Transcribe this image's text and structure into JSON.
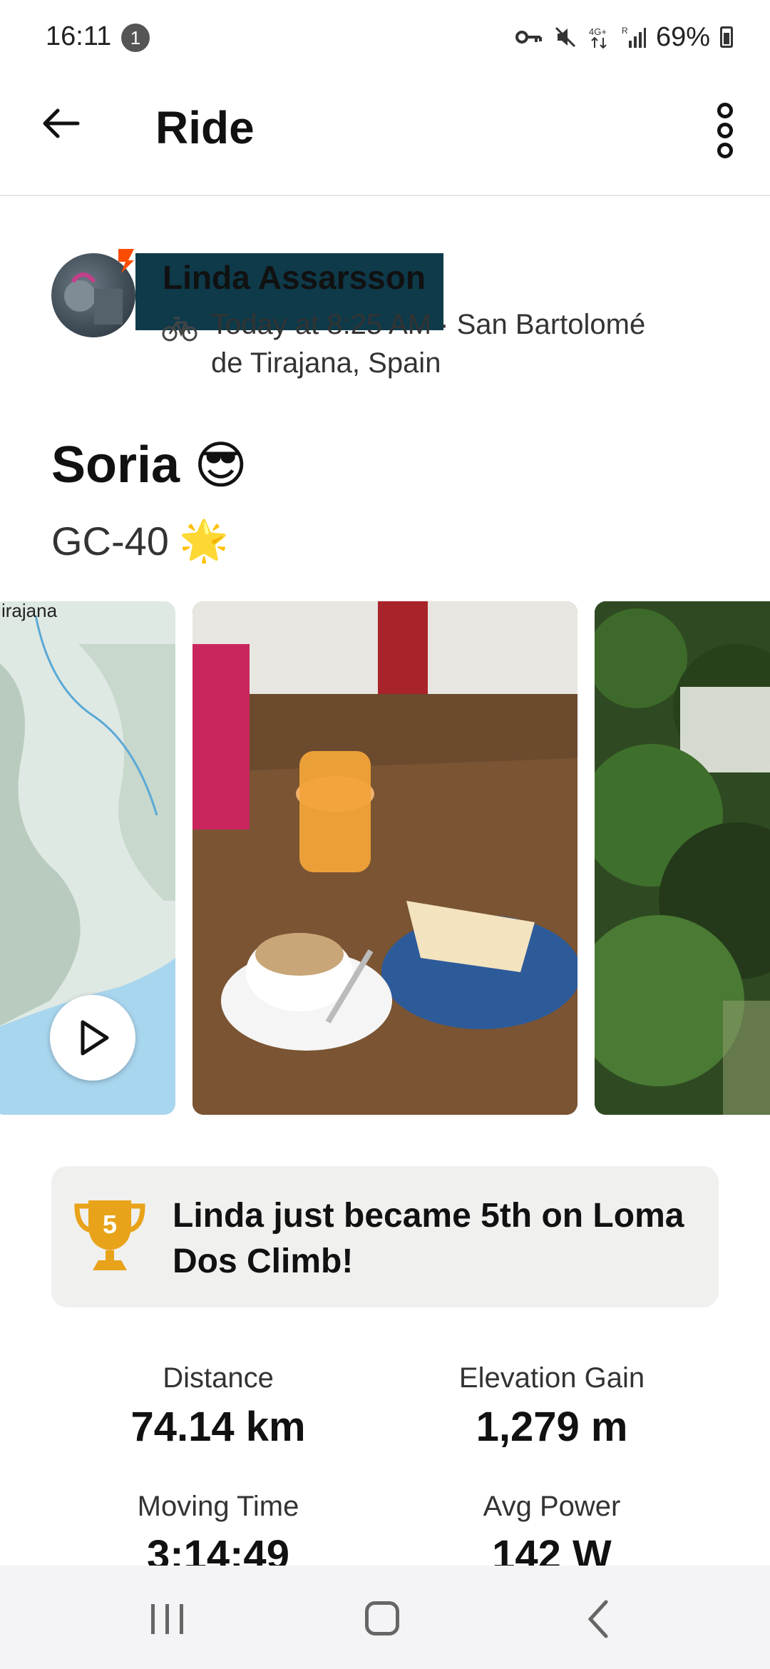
{
  "status_bar": {
    "time": "16:11",
    "notification_count": "1",
    "battery": "69%",
    "icons": [
      "key-icon",
      "mute-icon",
      "4g-icon",
      "signal-icon",
      "battery-icon"
    ]
  },
  "header": {
    "title": "Ride",
    "back_icon": "arrow-left-icon",
    "more_icon": "more-vertical-icon"
  },
  "activity": {
    "athlete_name": "Linda Assarsson",
    "meta": "Today at 8:25 AM · San Bartolomé de Tirajana, Spain",
    "title": "Soria",
    "title_emoji": "😎",
    "description": "GC-40",
    "description_emoji": "🌟",
    "sport_icon": "bike-icon"
  },
  "media": {
    "map_label": "irajana",
    "play_icon": "play-icon"
  },
  "achievement": {
    "text": "Linda just became 5th on Loma Dos Climb!",
    "rank": "5",
    "icon": "trophy-icon",
    "accent": "#e8a31a"
  },
  "stats": [
    {
      "label": "Distance",
      "value": "74.14 km"
    },
    {
      "label": "Elevation Gain",
      "value": "1,279 m"
    },
    {
      "label": "Moving Time",
      "value": "3:14:49"
    },
    {
      "label": "Avg Power",
      "value": "142 W"
    }
  ],
  "nav_bar": {
    "icons": [
      "recents-icon",
      "home-icon",
      "back-icon"
    ]
  },
  "colors": {
    "brand": "#fc4c02",
    "redaction": "#0e3a4a"
  }
}
